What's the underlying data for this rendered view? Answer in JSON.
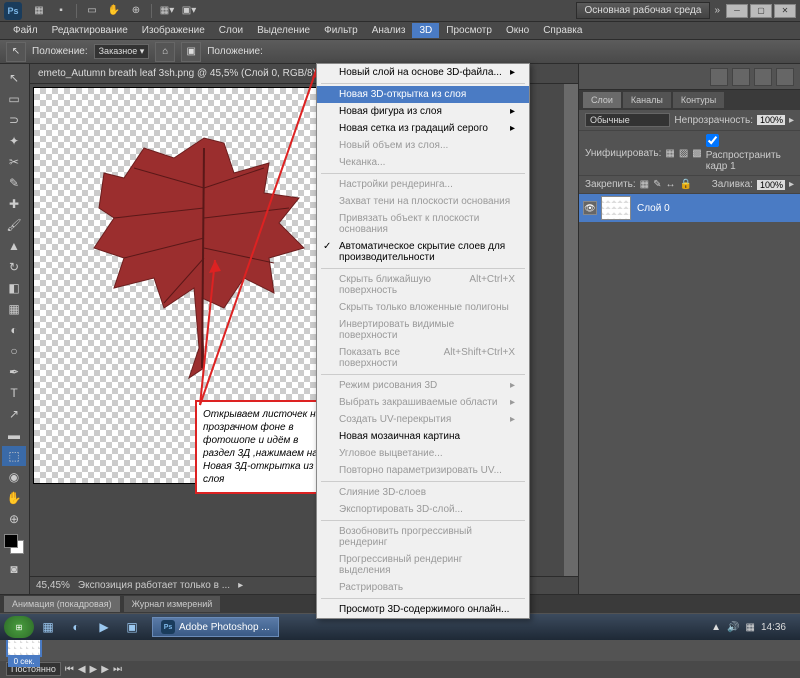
{
  "app": {
    "logo": "Ps",
    "workspace": "Основная рабочая среда"
  },
  "menu": [
    "Файл",
    "Редактирование",
    "Изображение",
    "Слои",
    "Выделение",
    "Фильтр",
    "Анализ",
    "3D",
    "Просмотр",
    "Окно",
    "Справка"
  ],
  "menu_active_index": 7,
  "optbar": {
    "label1": "Положение:",
    "preset": "Заказное ▾",
    "label2": "Положение:"
  },
  "doc": {
    "title": "emeto_Autumn breath leaf 3sh.png @ 45,5% (Слой 0, RGB/8)"
  },
  "status": {
    "zoom": "45,45%",
    "info": "Экспозиция работает только в ...",
    "dims": ""
  },
  "panels": {
    "layers_tabs": [
      "Слои",
      "Каналы",
      "Контуры"
    ],
    "blend": "Обычные",
    "opacity_label": "Непрозрачность:",
    "opacity": "100%",
    "unify": "Унифицировать:",
    "propagate": "Распространить кадр 1",
    "lock": "Закрепить:",
    "fill_label": "Заливка:",
    "fill": "100%",
    "layer_name": "Слой 0"
  },
  "anim": {
    "tab1": "Анимация (покадровая)",
    "tab2": "Журнал измерений",
    "frame_time": "0 сек.",
    "loop": "Постоянно"
  },
  "taskbar": {
    "app": "Adobe Photoshop ...",
    "time": "14:36"
  },
  "dropdown": [
    {
      "t": "Новый слой на основе 3D-файла...",
      "arr": "▸"
    },
    {
      "sep": 1
    },
    {
      "t": "Новая 3D-открытка из слоя",
      "hl": 1
    },
    {
      "t": "Новая фигура из слоя",
      "arr": "▸"
    },
    {
      "t": "Новая сетка из градаций серого",
      "arr": "▸"
    },
    {
      "t": "Новый объем из слоя...",
      "dis": 1
    },
    {
      "t": "Чеканка...",
      "dis": 1
    },
    {
      "sep": 1
    },
    {
      "t": "Настройки рендеринга...",
      "dis": 1
    },
    {
      "t": "Захват тени на плоскости основания",
      "dis": 1
    },
    {
      "t": "Привязать объект к плоскости основания",
      "dis": 1
    },
    {
      "t": "Автоматическое скрытие слоев для производительности",
      "check": 1
    },
    {
      "sep": 1
    },
    {
      "t": "Скрыть ближайшую поверхность",
      "dis": 1,
      "sc": "Alt+Ctrl+X"
    },
    {
      "t": "Скрыть только вложенные полигоны",
      "dis": 1
    },
    {
      "t": "Инвертировать видимые поверхности",
      "dis": 1
    },
    {
      "t": "Показать все поверхности",
      "dis": 1,
      "sc": "Alt+Shift+Ctrl+X"
    },
    {
      "sep": 1
    },
    {
      "t": "Режим рисования 3D",
      "dis": 1,
      "arr": "▸"
    },
    {
      "t": "Выбрать закрашиваемые области",
      "dis": 1,
      "arr": "▸"
    },
    {
      "t": "Создать UV-перекрытия",
      "dis": 1,
      "arr": "▸"
    },
    {
      "t": "Новая мозаичная картина"
    },
    {
      "t": "Угловое выцветание...",
      "dis": 1
    },
    {
      "t": "Повторно параметризировать UV...",
      "dis": 1
    },
    {
      "sep": 1
    },
    {
      "t": "Слияние 3D-слоев",
      "dis": 1
    },
    {
      "t": "Экспортировать 3D-слой...",
      "dis": 1
    },
    {
      "sep": 1
    },
    {
      "t": "Возобновить прогрессивный рендеринг",
      "dis": 1
    },
    {
      "t": "Прогрессивный рендеринг выделения",
      "dis": 1
    },
    {
      "t": "Растрировать",
      "dis": 1
    },
    {
      "sep": 1
    },
    {
      "t": "Просмотр 3D-содержимого онлайн..."
    }
  ],
  "annotation": "Открываем листочек на прозрачном фоне в фотошопе и идём в раздел 3Д ,нажимаем на Новая 3Д-открытка из слоя"
}
